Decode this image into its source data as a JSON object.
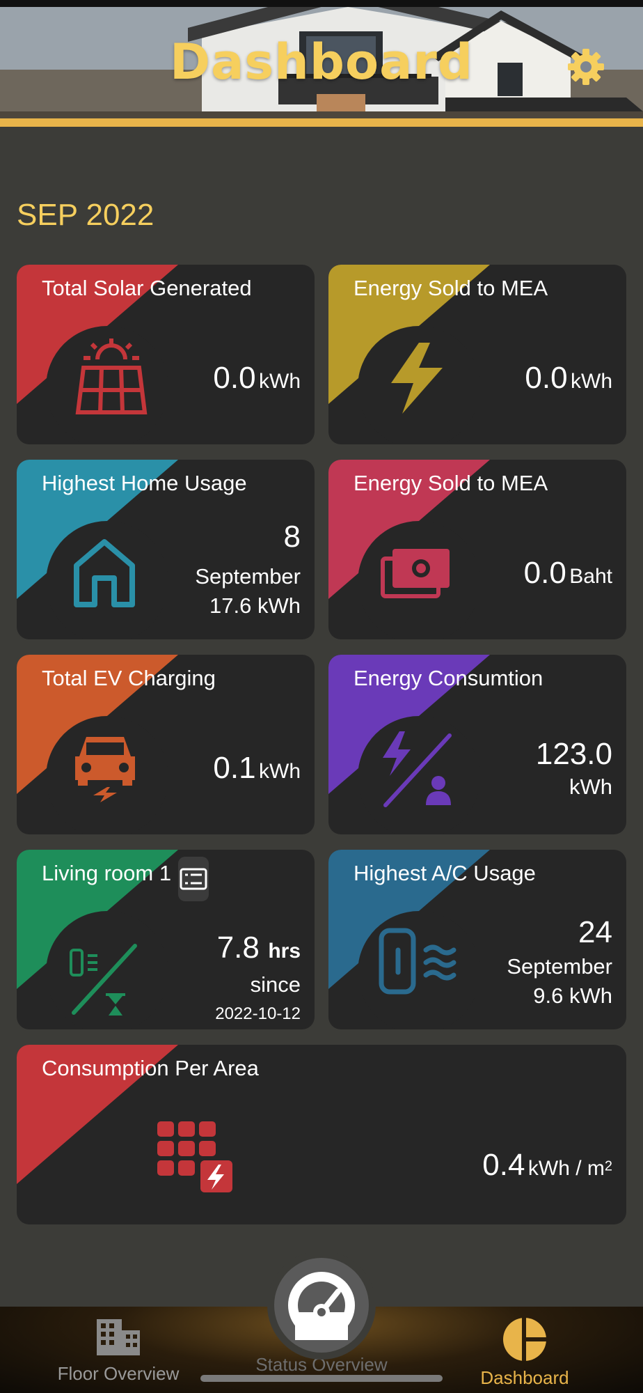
{
  "header": {
    "title": "Dashboard"
  },
  "period": "SEP 2022",
  "colors": {
    "accent": "#f6cf5e",
    "solar": "#c4363a",
    "mea_sold": "#b79a2a",
    "home": "#2a90a8",
    "mea_baht": "#c03854",
    "ev": "#cc5a2c",
    "consumption": "#6a3ab8",
    "living": "#1e8e5a",
    "ac": "#2a6a8e",
    "area": "#c4363a"
  },
  "cards": {
    "solar": {
      "title": "Total Solar Generated",
      "value": "0.0",
      "unit": "kWh",
      "icon": "solar-panel-icon"
    },
    "mea_kwh": {
      "title": "Energy Sold to MEA",
      "value": "0.0",
      "unit": "kWh",
      "icon": "lightning-icon"
    },
    "home_usage": {
      "title": "Highest Home Usage",
      "day": "8",
      "month": "September",
      "amount": "17.6 kWh",
      "icon": "house-icon"
    },
    "mea_baht": {
      "title": "Energy Sold to MEA",
      "value": "0.0",
      "unit": "Baht",
      "icon": "cash-icon"
    },
    "ev": {
      "title": "Total EV Charging",
      "value": "0.1",
      "unit": "kWh",
      "icon": "ev-car-icon"
    },
    "consumption": {
      "title": "Energy Consumtion",
      "value": "123.0",
      "unit": "kWh",
      "icon": "energy-person-icon"
    },
    "living": {
      "title": "Living room 1",
      "value": "7.8",
      "unit": "hrs",
      "since": "since",
      "date": "2022-10-12",
      "icon": "ac-timer-icon"
    },
    "ac_usage": {
      "title": "Highest A/C Usage",
      "day": "24",
      "month": "September",
      "amount": "9.6 kWh",
      "icon": "air-conditioner-icon"
    },
    "area": {
      "title": "Consumption Per Area",
      "value": "0.4",
      "unit": "kWh / m",
      "sup": "2",
      "icon": "grid-energy-icon"
    }
  },
  "nav": {
    "floor": "Floor Overview",
    "status": "Status Overview",
    "dashboard": "Dashboard"
  }
}
